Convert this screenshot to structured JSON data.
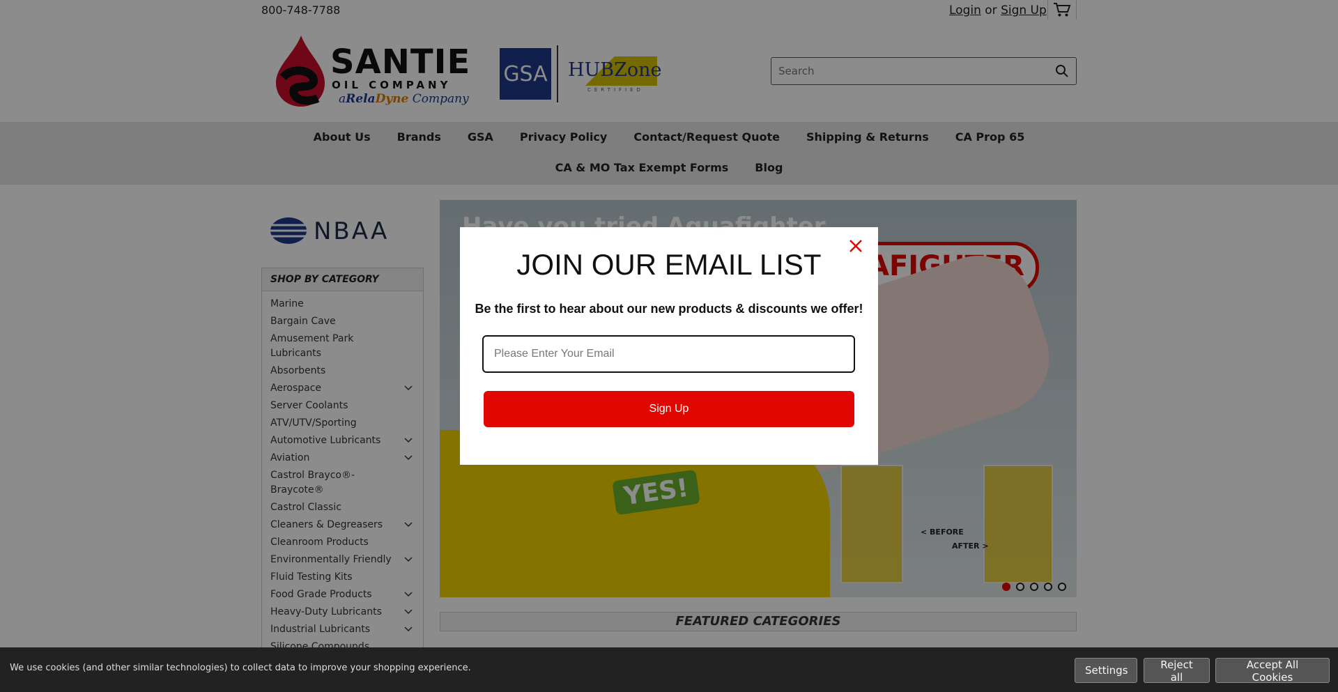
{
  "header": {
    "phone": "800-748-7788",
    "login_label": "Login",
    "or_label": "or",
    "signup_label": "Sign Up",
    "brand_name": "SANTIE",
    "brand_sub": "OIL COMPANY",
    "brand_tagline_a": "a",
    "brand_tagline_rela": "Rela",
    "brand_tagline_dyne": "Dyne",
    "brand_tagline_company": "Company",
    "gsa_label": "GSA",
    "hubzone_label": "HUBZone",
    "hubzone_certified": "CERTIFIED",
    "search_placeholder": "Search"
  },
  "nav": {
    "row1": [
      "About Us",
      "Brands",
      "GSA",
      "Privacy Policy",
      "Contact/Request Quote",
      "Shipping & Returns",
      "CA Prop 65"
    ],
    "row2": [
      "CA & MO Tax Exempt Forms",
      "Blog"
    ]
  },
  "sidebar": {
    "nbaa_label": "NBAA",
    "title": "SHOP BY CATEGORY",
    "items": [
      {
        "label": "Marine",
        "expandable": false
      },
      {
        "label": "Bargain Cave",
        "expandable": false
      },
      {
        "label": "Amusement Park Lubricants",
        "expandable": false
      },
      {
        "label": "Absorbents",
        "expandable": false
      },
      {
        "label": "Aerospace",
        "expandable": true
      },
      {
        "label": "Server Coolants",
        "expandable": false
      },
      {
        "label": "ATV/UTV/Sporting",
        "expandable": false
      },
      {
        "label": "Automotive Lubricants",
        "expandable": true
      },
      {
        "label": "Aviation",
        "expandable": true
      },
      {
        "label": "Castrol Brayco®-Braycote®",
        "expandable": false
      },
      {
        "label": "Castrol Classic",
        "expandable": false
      },
      {
        "label": "Cleaners & Degreasers",
        "expandable": true
      },
      {
        "label": "Cleanroom Products",
        "expandable": false
      },
      {
        "label": "Environmentally Friendly",
        "expandable": true
      },
      {
        "label": "Fluid Testing Kits",
        "expandable": false
      },
      {
        "label": "Food Grade Products",
        "expandable": true
      },
      {
        "label": "Heavy-Duty Lubricants",
        "expandable": true
      },
      {
        "label": "Industrial Lubricants",
        "expandable": true
      },
      {
        "label": "Silicone Compounds",
        "expandable": false
      }
    ]
  },
  "banner": {
    "heading": "Have you tried Aquafighter",
    "brand": "AFIGHTER",
    "yes_label": "YES!",
    "before_label": "< BEFORE",
    "after_label": "AFTER >",
    "slide_count": 5,
    "active_slide": 1
  },
  "featured": {
    "title": "FEATURED CATEGORIES"
  },
  "modal": {
    "title": "JOIN OUR EMAIL LIST",
    "subtitle": "Be the first to hear about our new products & discounts we offer!",
    "email_placeholder": "Please Enter Your Email",
    "signup_label": "Sign Up"
  },
  "cookie": {
    "message": "We use cookies (and other similar technologies) to collect data to improve your shopping experience.",
    "settings_label": "Settings",
    "reject_label": "Reject all",
    "accept_label": "Accept All Cookies"
  },
  "colors": {
    "brand_red": "#e10600",
    "nav_bg": "#e6e6e6",
    "cookie_bg": "#222222"
  }
}
